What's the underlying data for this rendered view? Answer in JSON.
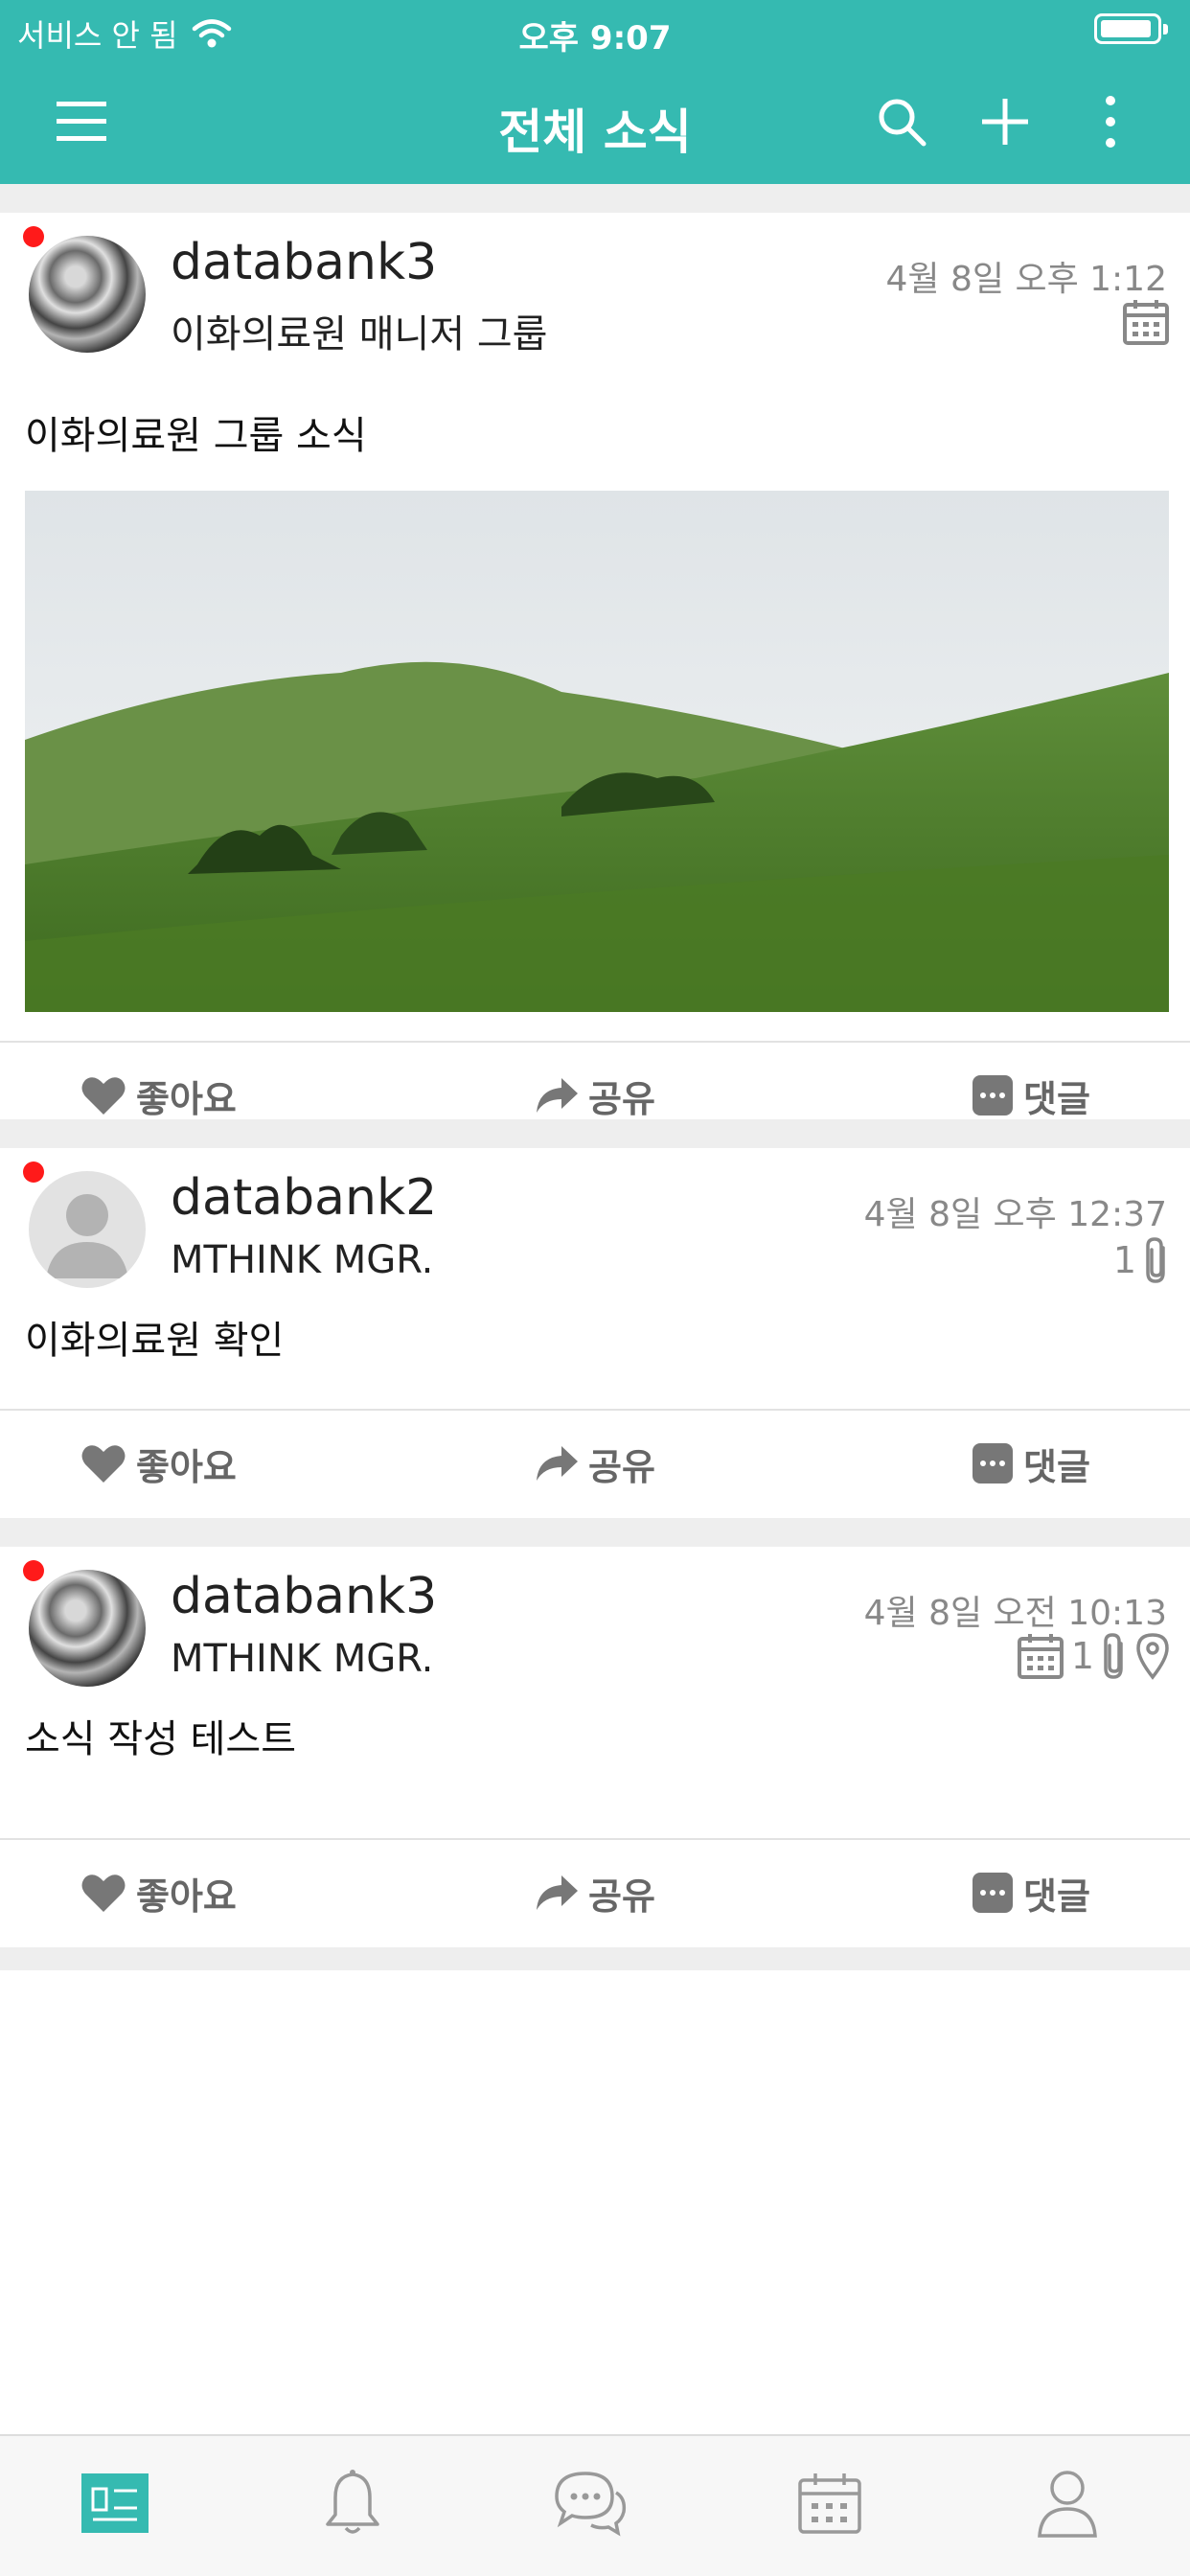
{
  "status_bar": {
    "carrier": "서비스 안 됨",
    "time": "오후 9:07"
  },
  "nav": {
    "title": "전체 소식",
    "icons": [
      "menu-icon",
      "search-icon",
      "plus-icon",
      "more-vertical-icon"
    ]
  },
  "posts": [
    {
      "author": "databank3",
      "group": "이화의료원 매니저 그룹",
      "date": "4월 8일 오후 1:12",
      "body": "이화의료원 그룹 소식",
      "has_calendar": true,
      "attachment_count": "",
      "has_location": false,
      "image": "green-hill-landscape",
      "unread": true
    },
    {
      "author": "databank2",
      "group": "MTHINK MGR.",
      "date": "4월 8일 오후 12:37",
      "body": "이화의료원 확인",
      "has_calendar": false,
      "attachment_count": "1",
      "has_location": false,
      "unread": true
    },
    {
      "author": "databank3",
      "group": "MTHINK MGR.",
      "date": "4월 8일 오전 10:13",
      "body": "소식 작성 테스트",
      "has_calendar": true,
      "attachment_count": "1",
      "has_location": true,
      "unread": true
    }
  ],
  "actions": {
    "like": "좋아요",
    "share": "공유",
    "comment": "댓글"
  },
  "tabbar": {
    "items": [
      "news-icon",
      "bell-icon",
      "chat-icon",
      "calendar-icon",
      "person-icon"
    ],
    "active_index": 0
  },
  "colors": {
    "accent": "#35bab1",
    "unread_dot": "#ff1a1a"
  }
}
